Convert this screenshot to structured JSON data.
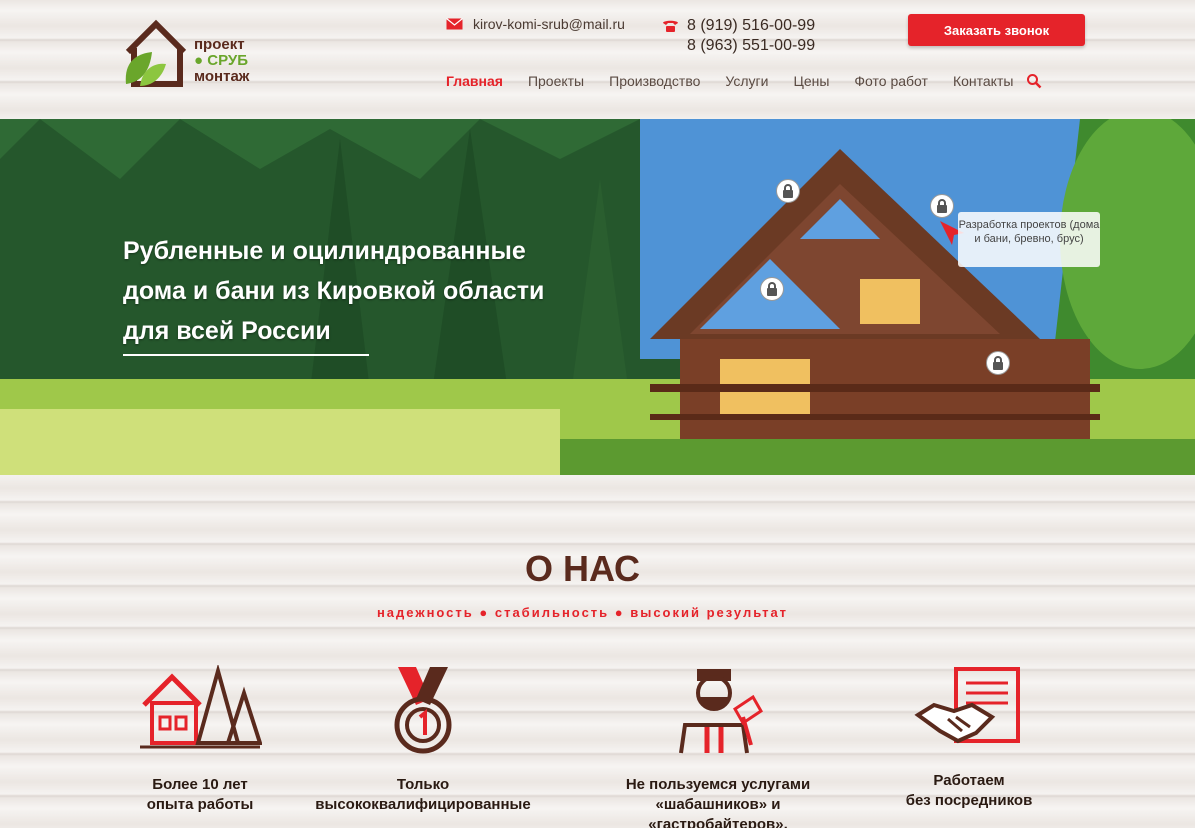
{
  "header": {
    "logo": {
      "line1": "проект",
      "line2": "СРУБ",
      "line3": "монтаж"
    },
    "email": "kirov-komi-srub@mail.ru",
    "phones": [
      "8 (919) 516-00-99",
      "8 (963) 551-00-99"
    ],
    "call_button": "Заказать звонок",
    "nav": [
      "Главная",
      "Проекты",
      "Производство",
      "Услуги",
      "Цены",
      "Фото работ",
      "Контакты"
    ],
    "nav_active": "Главная"
  },
  "hero": {
    "title_line1": "Рубленные и оцилиндрованные",
    "title_line2": "дома и бани из Кировкой области",
    "title_line3": "для всей России",
    "tooltip": "Разработка проектов (дома и бани, бревно, брус)"
  },
  "about": {
    "title": "О НАС",
    "subtitle": "надежность  ●  стабильность  ●  высокий результат",
    "features": [
      {
        "text1": "Более 10 лет",
        "text2": "опыта работы"
      },
      {
        "text1": "Только",
        "text2": "высококвалифицированные"
      },
      {
        "text1": "Не пользуемся услугами",
        "text2": "«шабашников» и «гастробайтеров»,"
      },
      {
        "text1": "Работаем",
        "text2": "без посредников"
      }
    ]
  },
  "colors": {
    "accent": "#e5232a",
    "brand_brown": "#5a2a1d",
    "brand_green": "#6aa62b"
  }
}
